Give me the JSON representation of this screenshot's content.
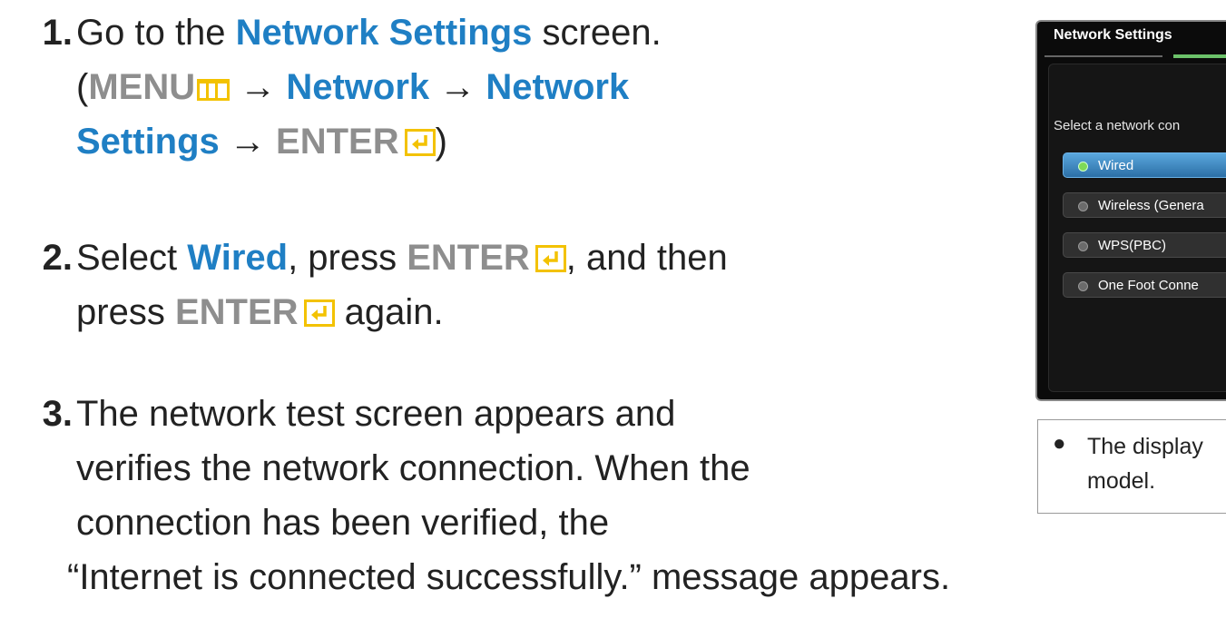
{
  "steps": [
    {
      "num": "1.",
      "go_to": "Go to the ",
      "network_settings": "Network Settings",
      "screen": " screen.",
      "open_paren": "(",
      "menu": "MENU",
      "arrow1": " → ",
      "network": "Network",
      "arrow2": " → ",
      "network2": "Network",
      "settings": "Settings",
      "arrow3": " → ",
      "enter": "ENTER",
      "close_paren": ")"
    },
    {
      "num": "2.",
      "select": "Select ",
      "wired": "Wired",
      "press": ", press ",
      "enter": "ENTER",
      "and_then": ", and then",
      "press2": "press ",
      "enter2": "ENTER",
      "again": " again."
    },
    {
      "num": "3.",
      "line1": "The network test screen appears and",
      "line2": "verifies the network connection. When the",
      "line3": "connection has been verified, the",
      "line4": "“Internet is connected successfully.” message appears."
    }
  ],
  "tv": {
    "title": "Network Settings",
    "prompt": "Select a network con",
    "options": [
      {
        "label": "Wired",
        "selected": true
      },
      {
        "label": "Wireless (Genera",
        "selected": false
      },
      {
        "label": "WPS(PBC)",
        "selected": false
      },
      {
        "label": "One Foot Conne",
        "selected": false
      }
    ]
  },
  "note": {
    "bullet": "●",
    "line1": "The display",
    "line2": "model."
  },
  "colors": {
    "accent_blue": "#1f7fc4",
    "key_grey": "#8e8e8e",
    "icon_yellow": "#f3c200"
  },
  "icons": {
    "menu": "menu-button-icon",
    "enter": "enter-key-icon"
  }
}
